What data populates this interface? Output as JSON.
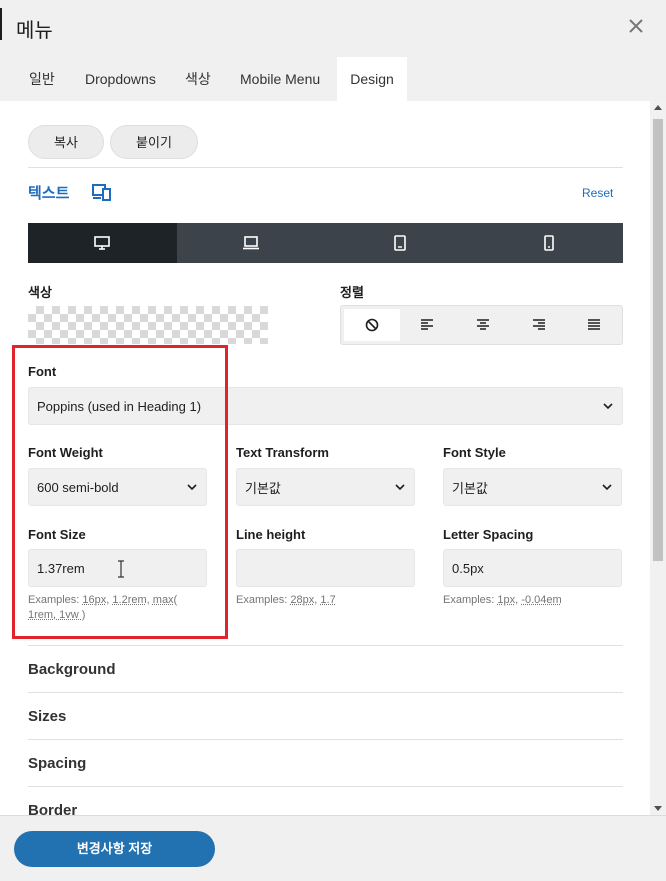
{
  "header": {
    "title": "메뉴",
    "close_icon": "close-icon"
  },
  "tabs": [
    {
      "label": "일반",
      "active": false
    },
    {
      "label": "Dropdowns",
      "active": false
    },
    {
      "label": "색상",
      "active": false
    },
    {
      "label": "Mobile Menu",
      "active": false
    },
    {
      "label": "Design",
      "active": true
    }
  ],
  "toolbar": {
    "copy_label": "복사",
    "paste_label": "붙이기"
  },
  "text_section": {
    "title": "텍스트",
    "responsive_icon": "devices-icon",
    "reset_label": "Reset"
  },
  "devices": [
    {
      "name": "desktop",
      "icon": "desktop-icon",
      "active": true
    },
    {
      "name": "laptop",
      "icon": "laptop-icon",
      "active": false
    },
    {
      "name": "tablet",
      "icon": "tablet-icon",
      "active": false
    },
    {
      "name": "mobile",
      "icon": "mobile-icon",
      "active": false
    }
  ],
  "color": {
    "label": "색상"
  },
  "alignment": {
    "label": "정렬",
    "options": [
      "none-icon",
      "align-left-icon",
      "align-center-icon",
      "align-right-icon",
      "align-justify-icon"
    ]
  },
  "font": {
    "label": "Font",
    "value": "Poppins (used in Heading 1)"
  },
  "font_weight": {
    "label": "Font Weight",
    "value": "600 semi-bold"
  },
  "text_transform": {
    "label": "Text Transform",
    "value": "기본값"
  },
  "font_style": {
    "label": "Font Style",
    "value": "기본값"
  },
  "font_size": {
    "label": "Font Size",
    "value": "1.37rem",
    "help_prefix": "Examples:",
    "help_examples": [
      "16px",
      "1.2rem",
      "max(",
      "1rem, 1vw )"
    ]
  },
  "line_height": {
    "label": "Line height",
    "value": "",
    "help_prefix": "Examples:",
    "help_examples": [
      "28px",
      "1.7"
    ]
  },
  "letter_spacing": {
    "label": "Letter Spacing",
    "value": "0.5px",
    "help_prefix": "Examples:",
    "help_examples": [
      "1px",
      "-0.04em"
    ]
  },
  "accordions": [
    "Background",
    "Sizes",
    "Spacing",
    "Border"
  ],
  "footer": {
    "save_label": "변경사항 저장"
  },
  "colors": {
    "accent": "#2271b1",
    "link": "#1e6cc0",
    "highlight": "#e0242b",
    "device_bar": "#3c434a"
  }
}
